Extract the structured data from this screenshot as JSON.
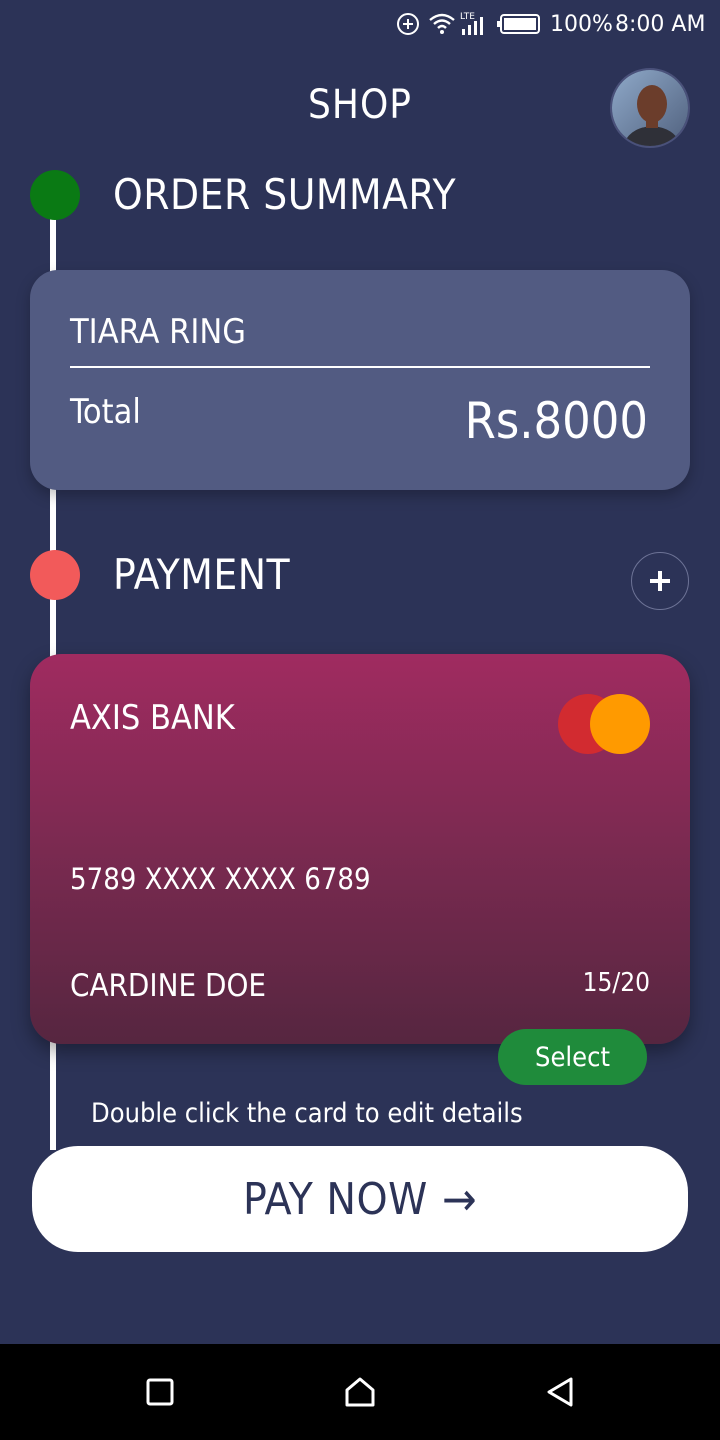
{
  "status_bar": {
    "battery_percent": "100%",
    "time": "8:00 AM",
    "network_label": "LTE",
    "icons": [
      "data-saver-icon",
      "wifi-icon",
      "cell-signal-icon",
      "battery-icon"
    ]
  },
  "header": {
    "title": "SHOP",
    "avatar_icon": "user-avatar"
  },
  "order_summary": {
    "title": "ORDER SUMMARY",
    "step_color": "#0a7a14",
    "item_name": "TIARA RING",
    "total_label": "Total",
    "total_value": "Rs.8000"
  },
  "payment": {
    "title": "PAYMENT",
    "step_color": "#f25a5a",
    "add_button_icon": "plus-icon",
    "card": {
      "bank_name": "AXIS BANK",
      "number": "5789 XXXX XXXX 6789",
      "holder": "CARDINE DOE",
      "expiry": "15/20",
      "brand_icon": "mastercard-logo"
    },
    "select_label": "Select",
    "hint": "Double click the card to edit details"
  },
  "pay_now": {
    "label": "PAY NOW",
    "arrow": "→"
  },
  "nav_bar": {
    "icons": [
      "recents-square-icon",
      "home-icon",
      "back-triangle-icon"
    ]
  },
  "colors": {
    "background": "#2c3357",
    "summary_card": "#525b82",
    "select_button": "#1f8b3b",
    "mastercard_red": "#d22b30",
    "mastercard_orange": "#ff9a00"
  }
}
